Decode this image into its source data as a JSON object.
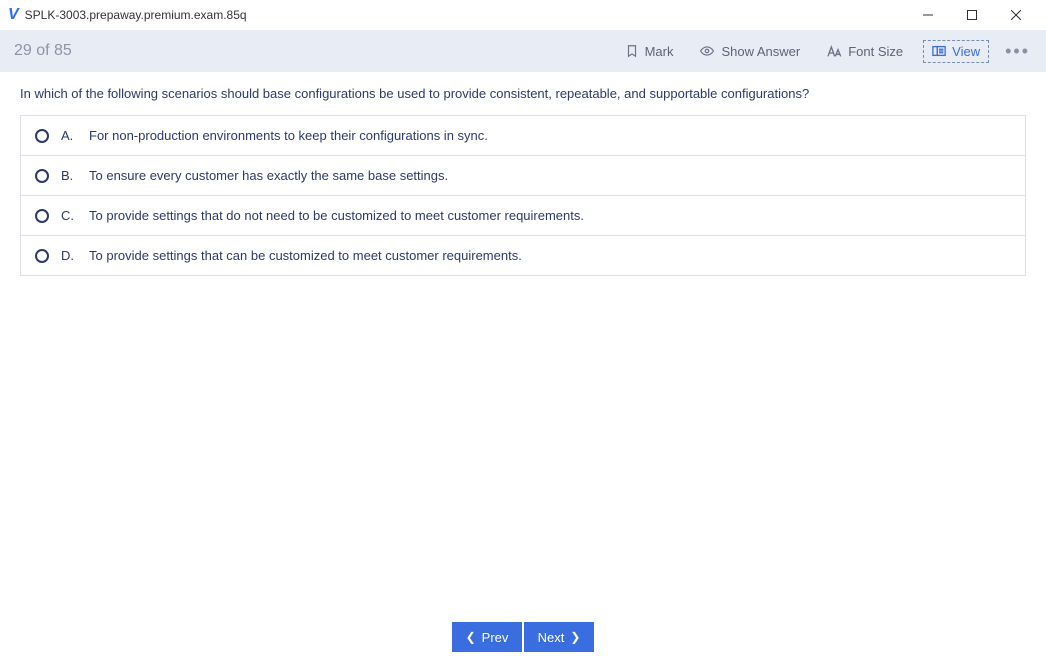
{
  "titlebar": {
    "title": "SPLK-3003.prepaway.premium.exam.85q"
  },
  "toolbar": {
    "progress": "29 of 85",
    "mark": "Mark",
    "show_answer": "Show Answer",
    "font_size": "Font Size",
    "view": "View"
  },
  "question": {
    "text": "In which of the following scenarios should base configurations be used to provide consistent, repeatable, and supportable configurations?",
    "options": [
      {
        "letter": "A.",
        "text": "For non-production environments to keep their configurations in sync."
      },
      {
        "letter": "B.",
        "text": "To ensure every customer has exactly the same base settings."
      },
      {
        "letter": "C.",
        "text": "To provide settings that do not need to be customized to meet customer requirements."
      },
      {
        "letter": "D.",
        "text": "To provide settings that can be customized to meet customer requirements."
      }
    ]
  },
  "nav": {
    "prev": "Prev",
    "next": "Next"
  }
}
